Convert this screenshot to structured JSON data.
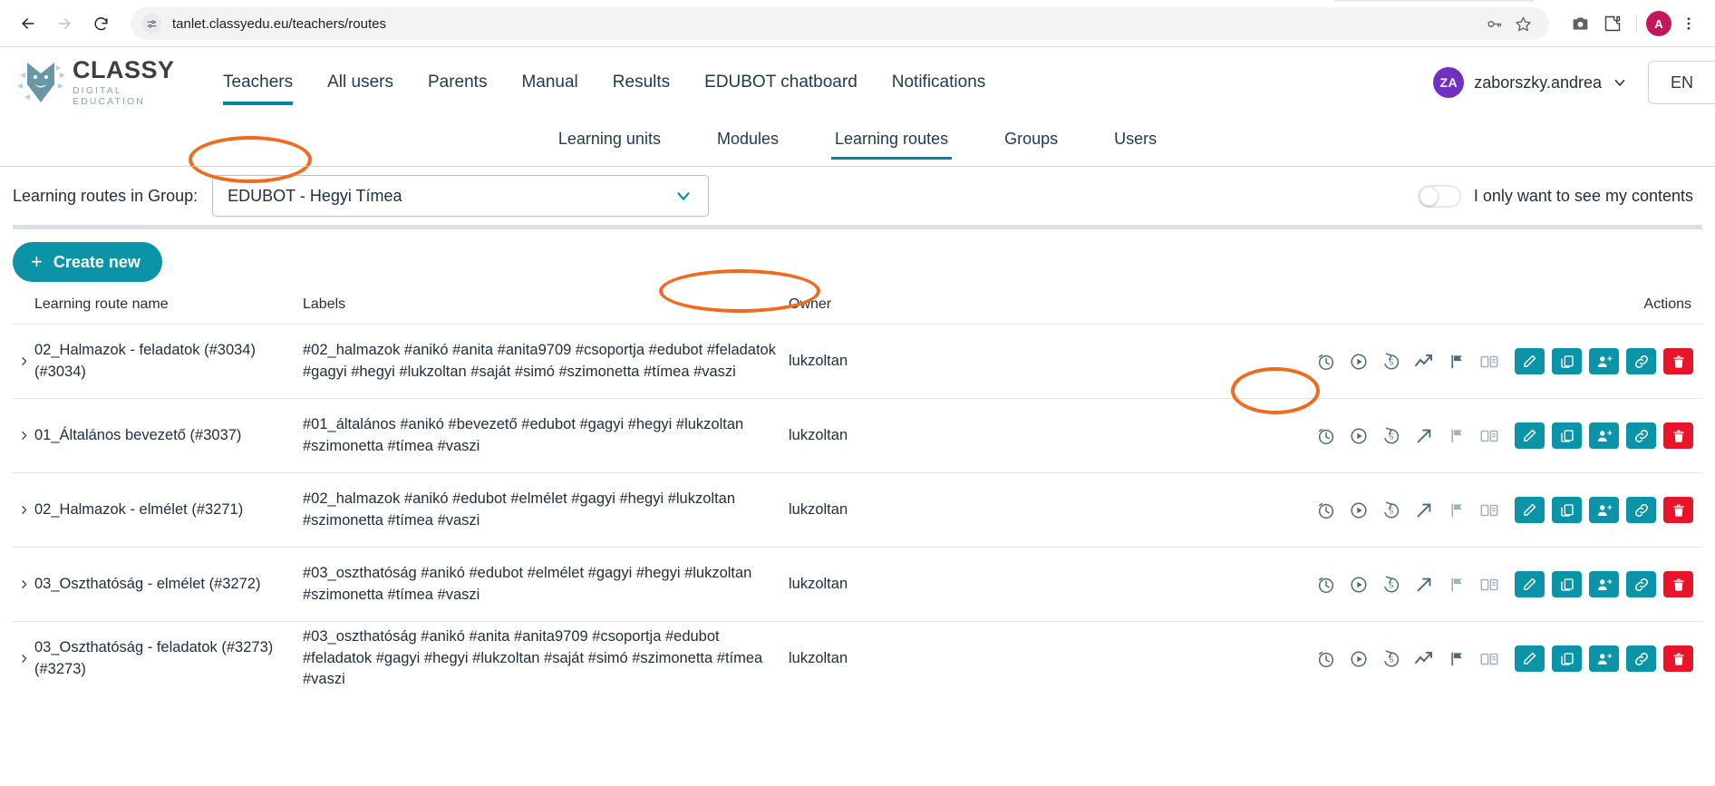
{
  "browser": {
    "back_icon": "back-arrow-icon",
    "forward_icon": "forward-arrow-icon",
    "reload_icon": "reload-icon",
    "site_info_icon": "site-settings-icon",
    "url": "tanlet.classyedu.eu/teachers/routes",
    "password_icon": "key-icon",
    "bookmark_icon": "star-icon",
    "screenshot_icon": "camera-icon",
    "extensions_icon": "puzzle-icon",
    "profile_initial": "A",
    "menu_icon": "kebab-menu-icon"
  },
  "header": {
    "logo": {
      "title": "CLASSY",
      "subtitle": "DIGITAL EDUCATION",
      "mark": "cat-logo-icon"
    },
    "nav": [
      {
        "label": "Teachers",
        "active": true
      },
      {
        "label": "All users",
        "active": false
      },
      {
        "label": "Parents",
        "active": false
      },
      {
        "label": "Manual",
        "active": false
      },
      {
        "label": "Results",
        "active": false
      },
      {
        "label": "EDUBOT chatboard",
        "active": false
      },
      {
        "label": "Notifications",
        "active": false
      }
    ],
    "user": {
      "initials": "ZA",
      "name": "zaborszky.andrea",
      "chevron": "chevron-down-icon",
      "avatar_color": "#7030c0"
    },
    "language": "EN"
  },
  "subnav": [
    {
      "label": "Learning units",
      "active": false
    },
    {
      "label": "Modules",
      "active": false
    },
    {
      "label": "Learning routes",
      "active": true
    },
    {
      "label": "Groups",
      "active": false
    },
    {
      "label": "Users",
      "active": false
    }
  ],
  "filter": {
    "label": "Learning routes in Group:",
    "group_value": "EDUBOT - Hegyi Tímea",
    "caret_icon": "chevron-down-icon",
    "toggle_label": "I only want to see my contents",
    "toggle_on": false
  },
  "actions": {
    "create_label": "Create new",
    "create_plus": "+"
  },
  "table": {
    "headers": {
      "name": "Learning route name",
      "labels": "Labels",
      "owner": "Owner",
      "actions": "Actions"
    },
    "rows": [
      {
        "name": "02_Halmazok - feladatok (#3034) (#3034)",
        "labels": "#02_halmazok #anikó #anita #anita9709 #csoportja #edubot #feladatok #gagyi #hegyi #lukzoltan #saját #simó #szimonetta #tímea #vaszi",
        "owner": "lukzoltan",
        "trend_icon": "trend-zigzag-icon",
        "flag_muted": false,
        "book_muted": true
      },
      {
        "name": "01_Általános bevezető (#3037)",
        "labels": "#01_általános #anikó #bevezető #edubot #gagyi #hegyi #lukzoltan #szimonetta #tímea #vaszi",
        "owner": "lukzoltan",
        "trend_icon": "arrow-up-right-icon",
        "flag_muted": true,
        "book_muted": true
      },
      {
        "name": "02_Halmazok - elmélet (#3271)",
        "labels": "#02_halmazok #anikó #edubot #elmélet #gagyi #hegyi #lukzoltan #szimonetta #tímea #vaszi",
        "owner": "lukzoltan",
        "trend_icon": "arrow-up-right-icon",
        "flag_muted": true,
        "book_muted": true
      },
      {
        "name": "03_Oszthatóság - elmélet (#3272)",
        "labels": "#03_oszthatóság #anikó #edubot #elmélet #gagyi #hegyi #lukzoltan #szimonetta #tímea #vaszi",
        "owner": "lukzoltan",
        "trend_icon": "arrow-up-right-icon",
        "flag_muted": true,
        "book_muted": true
      },
      {
        "name": "03_Oszthatóság - feladatok (#3273) (#3273)",
        "labels": "#03_oszthatóság #anikó #anita #anita9709 #csoportja #edubot #feladatok #gagyi #hegyi #lukzoltan #saját #simó #szimonetta #tímea #vaszi",
        "owner": "lukzoltan",
        "trend_icon": "trend-zigzag-icon",
        "flag_muted": false,
        "book_muted": true
      }
    ],
    "row_action_icons": [
      "timer-icon",
      "play-circle-icon",
      "history-restore-icon",
      "trend-icon",
      "flag-icon",
      "book-icon",
      "edit-pencil-icon",
      "duplicate-icon",
      "assign-users-icon",
      "link-icon",
      "delete-trash-icon"
    ],
    "expand_icon": "chevron-right-icon"
  },
  "annotations": [
    {
      "name": "teachers-highlight",
      "target": "Teachers"
    },
    {
      "name": "learning-routes-highlight",
      "target": "Learning routes"
    },
    {
      "name": "edit-duplicate-highlight",
      "target": "edit / duplicate buttons"
    }
  ],
  "colors": {
    "teal": "#0b94a8",
    "red": "#e8142a",
    "orange": "#f26a1b",
    "purple": "#7030c0",
    "dark": "#20303d"
  }
}
